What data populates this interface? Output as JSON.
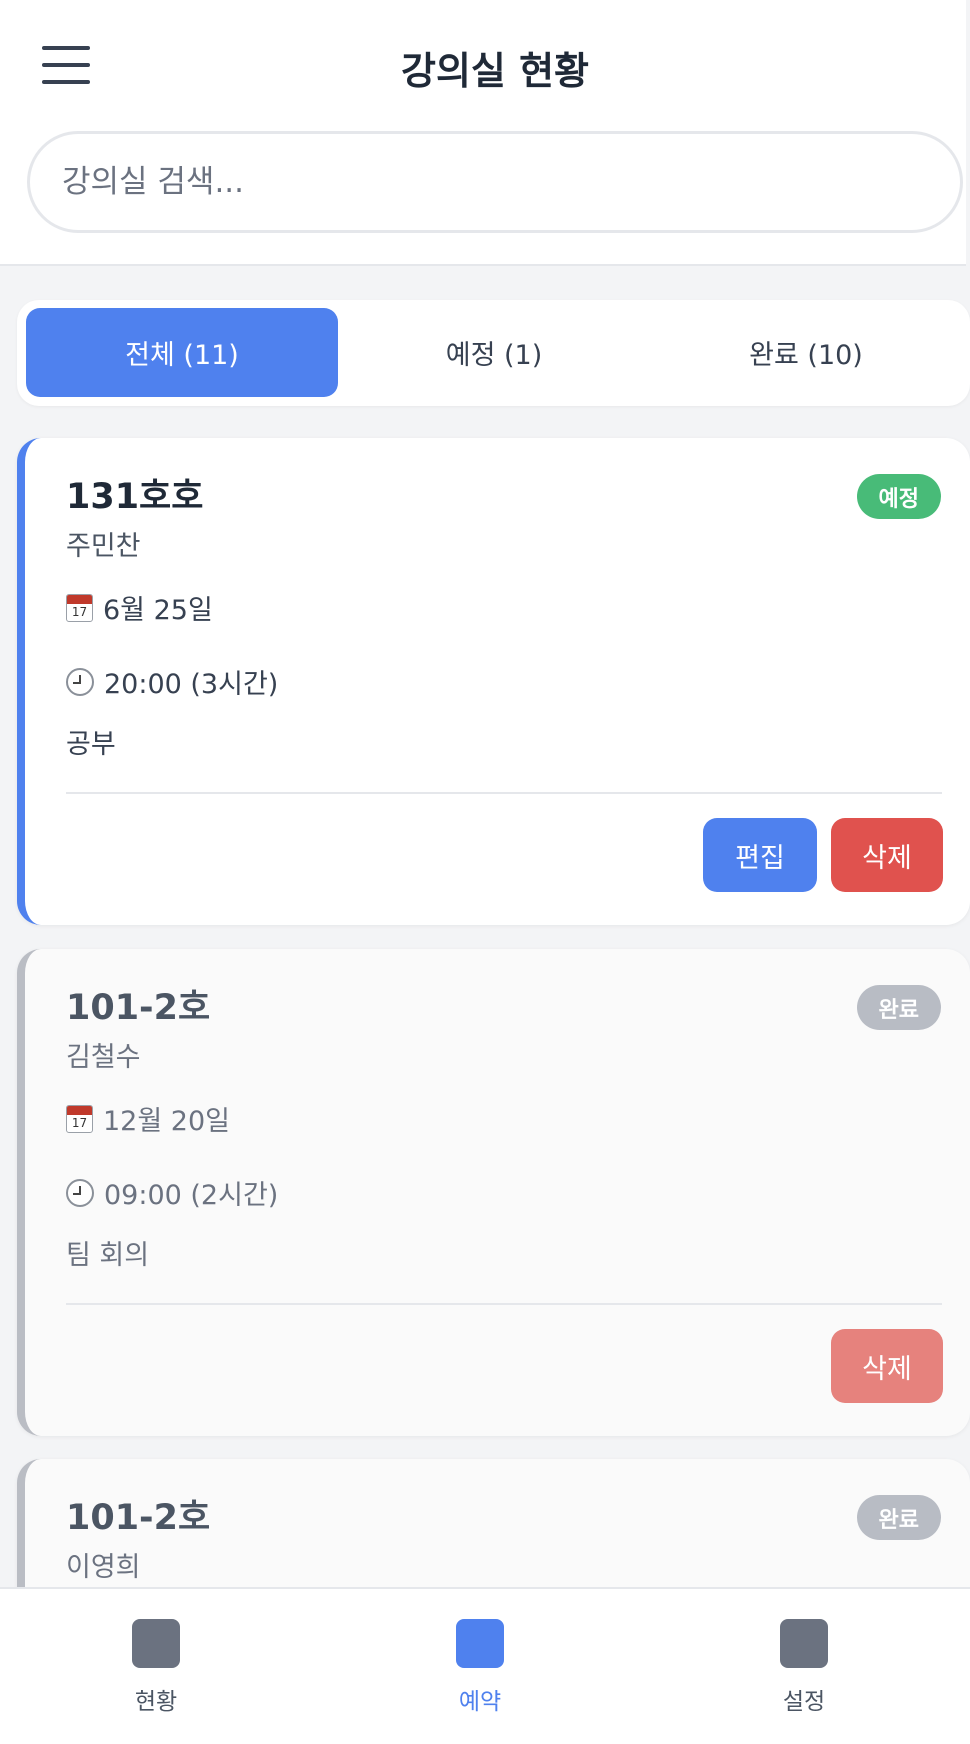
{
  "header": {
    "title": "강의실 현황",
    "search_placeholder": "강의실 검색..."
  },
  "tabs": [
    {
      "label": "전체 (11)",
      "active": true
    },
    {
      "label": "예정 (1)",
      "active": false
    },
    {
      "label": "완료 (10)",
      "active": false
    }
  ],
  "cards": [
    {
      "room": "131호호",
      "owner": "주민찬",
      "status": "예정",
      "date_icon": "calendar-icon",
      "calendar_num": "17",
      "date": "6월 25일",
      "time_icon": "clock-icon",
      "time": "20:00 (3시간)",
      "purpose": "공부",
      "edit_label": "편집",
      "delete_label": "삭제"
    },
    {
      "room": "101-2호",
      "owner": "김철수",
      "status": "완료",
      "date_icon": "calendar-icon",
      "calendar_num": "17",
      "date": "12월 20일",
      "time_icon": "clock-icon",
      "time": "09:00 (2시간)",
      "purpose": "팀 회의",
      "delete_label": "삭제"
    },
    {
      "room": "101-2호",
      "owner": "이영희",
      "status": "완료"
    }
  ],
  "colors": {
    "accent": "#4f81ee",
    "scheduled_badge": "#48bb78",
    "done_badge": "#b8bcc4",
    "delete": "#e0524e"
  },
  "bottom_nav": [
    {
      "label": "현황",
      "icon": "status-icon",
      "active": false
    },
    {
      "label": "예약",
      "icon": "reservation-icon",
      "active": true
    },
    {
      "label": "설정",
      "icon": "settings-icon",
      "active": false
    }
  ]
}
